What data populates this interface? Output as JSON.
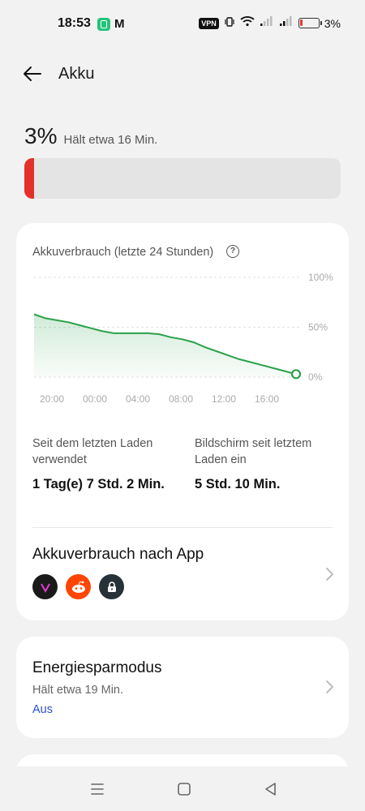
{
  "status_bar": {
    "time": "18:53",
    "vpn_label": "VPN",
    "battery_pct": "3%",
    "icons": [
      "app-notification-icon",
      "gmail-icon",
      "vpn-icon",
      "vibrate-icon",
      "wifi-icon",
      "signal-icon",
      "battery-icon"
    ]
  },
  "header": {
    "title": "Akku"
  },
  "battery": {
    "percent_label": "3%",
    "estimate": "Hält etwa 16 Min.",
    "level_fraction": 0.03,
    "level_color": "#e2312a"
  },
  "usage_card": {
    "title": "Akkuverbrauch (letzte 24 Stunden)",
    "since_charge_label": "Seit dem letzten Laden verwendet",
    "since_charge_value": "1 Tag(e) 7 Std. 2 Min.",
    "screen_on_label": "Bildschirm seit letztem Laden ein",
    "screen_on_value": "5 Std. 10 Min.",
    "by_app_title": "Akkuverbrauch nach App",
    "app_icons": [
      "vpn-app-icon",
      "reddit-icon",
      "lock-app-icon"
    ]
  },
  "chart_data": {
    "type": "area",
    "y_tick_labels": [
      "100%",
      "50%",
      "0%"
    ],
    "x_tick_labels": [
      "20:00",
      "00:00",
      "04:00",
      "08:00",
      "12:00",
      "16:00"
    ],
    "ylim": [
      0,
      100
    ],
    "line_color": "#2aa14a",
    "x_hours": [
      0,
      1,
      2,
      3,
      4,
      5,
      6,
      7,
      8,
      9,
      10,
      11,
      12,
      13,
      14,
      15,
      16,
      17,
      18,
      19,
      20,
      21,
      22,
      23
    ],
    "values": [
      63,
      59,
      57,
      55,
      52,
      49,
      46,
      44,
      44,
      44,
      44,
      43,
      40,
      38,
      35,
      30,
      26,
      22,
      18,
      15,
      12,
      9,
      6,
      3
    ]
  },
  "power_saving": {
    "title": "Energiesparmodus",
    "estimate": "Hält etwa 19 Min.",
    "status": "Aus"
  }
}
